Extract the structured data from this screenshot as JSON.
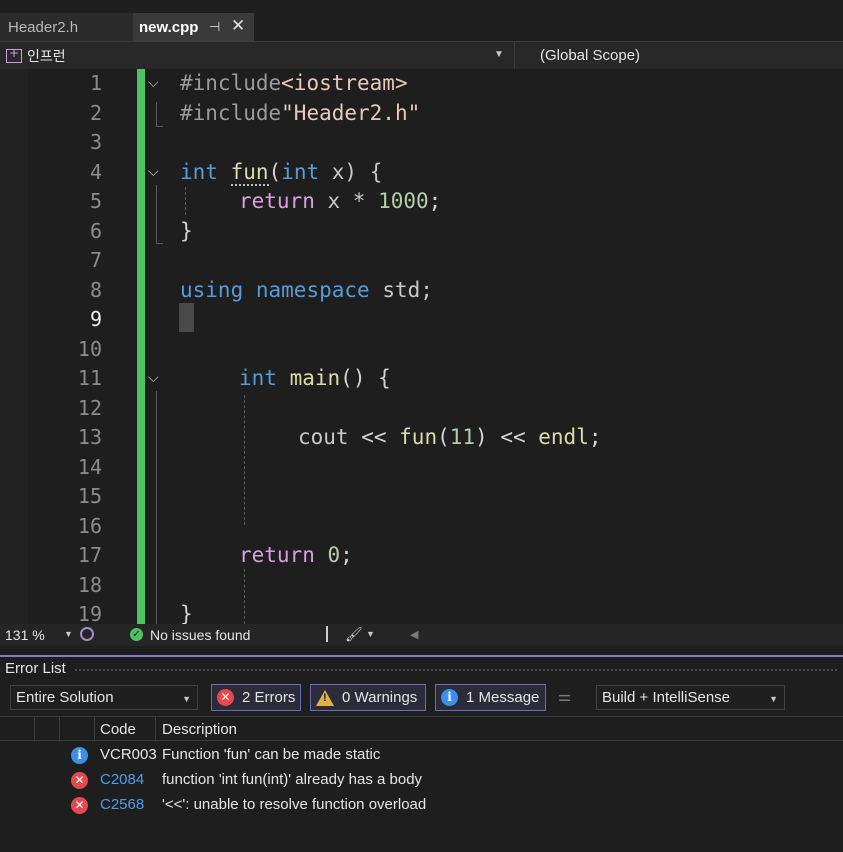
{
  "tabs": [
    {
      "label": "Header2.h",
      "active": false
    },
    {
      "label": "new.cpp",
      "active": true
    }
  ],
  "tab_icons": {
    "pin": "pin-icon",
    "close": "close-icon"
  },
  "navbar": {
    "project": "인프런",
    "scope": "(Global Scope)"
  },
  "editor": {
    "line_numbers": [
      "1",
      "2",
      "3",
      "4",
      "5",
      "6",
      "7",
      "8",
      "9",
      "10",
      "11",
      "12",
      "13",
      "14",
      "15",
      "16",
      "17",
      "18",
      "19"
    ],
    "current_line": "9",
    "tokens": {
      "l1": [
        "#include",
        "<iostream>"
      ],
      "l2": [
        "#include",
        "\"Header2.h\""
      ],
      "l4": [
        "int",
        " ",
        "fun",
        "(",
        "int",
        " x) {"
      ],
      "l5": [
        "return",
        " x * ",
        "1000",
        ";"
      ],
      "l6": [
        "}"
      ],
      "l8": [
        "using",
        " ",
        "namespace",
        " std;"
      ],
      "l11": [
        "int",
        " ",
        "main",
        "() {"
      ],
      "l13": [
        "cout",
        " << ",
        "fun",
        "(",
        "11",
        ") << ",
        "endl",
        ";"
      ],
      "l17": [
        "return",
        " ",
        "0",
        ";"
      ],
      "l19": [
        "}"
      ]
    }
  },
  "editor_status": {
    "zoom": "131 %",
    "issues": "No issues found"
  },
  "error_list": {
    "title": "Error List",
    "scope": "Entire Solution",
    "errors_btn": "2 Errors",
    "warnings_btn": "0 Warnings",
    "messages_btn": "1 Message",
    "build_mode": "Build + IntelliSense",
    "columns": {
      "code": "Code",
      "description": "Description"
    },
    "rows": [
      {
        "type": "info",
        "code": "VCR003",
        "description": "Function 'fun' can be made static"
      },
      {
        "type": "error",
        "code": "C2084",
        "description": "function 'int fun(int)' already has a body"
      },
      {
        "type": "error",
        "code": "C2568",
        "description": "'<<': unable to resolve function overload"
      }
    ]
  },
  "colors": {
    "keyword": "#569cd6",
    "control": "#d8a0df",
    "function": "#dcdcaa",
    "number": "#b5cea8",
    "change_bar": "#4ec160",
    "error": "#e5484d",
    "info": "#3b8eea"
  }
}
